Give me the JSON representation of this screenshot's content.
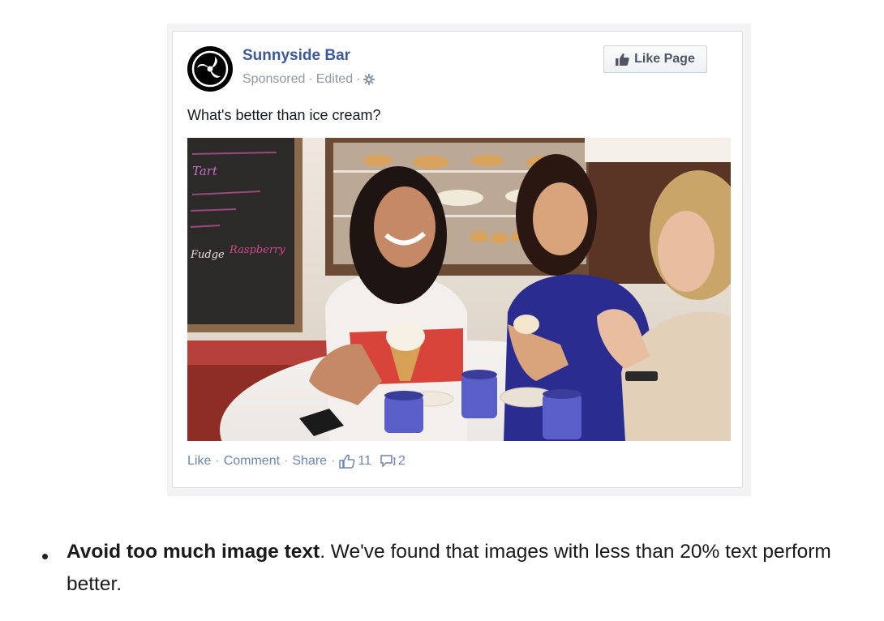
{
  "ad_card": {
    "page_name": "Sunnyside Bar",
    "sponsored_label": "Sponsored",
    "edited_label": "Edited",
    "separator": "·",
    "like_page_label": "Like Page",
    "post_text": "What's better than ice cream?",
    "photo_board_text": [
      "Tart",
      "Raspberry",
      "Fudge"
    ],
    "actions": {
      "like": "Like",
      "comment": "Comment",
      "share": "Share",
      "like_count": "11",
      "comment_count": "2"
    }
  },
  "tip": {
    "bold_text": "Avoid too much image text",
    "rest_text": ". We've found that images with less than 20% text perform better."
  },
  "colors": {
    "link_blue": "#3b5998",
    "action_blue": "#6d84b4",
    "meta_gray": "#9197a3",
    "body_text": "#141823"
  },
  "icons": {
    "logo": "swirl-logo-icon",
    "gear": "gear-icon",
    "thumbs_up": "thumbs-up-icon",
    "comment": "comment-bubble-icon"
  }
}
